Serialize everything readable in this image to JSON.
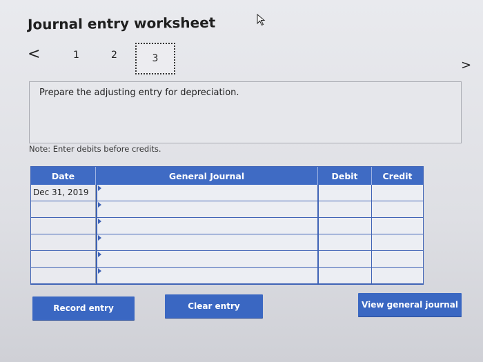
{
  "title": "Journal entry worksheet",
  "stepper": {
    "prev": "<",
    "steps": [
      "1",
      "2",
      "3"
    ],
    "next": ">"
  },
  "instruction": "Prepare the adjusting entry for depreciation.",
  "note": "Note: Enter debits before credits.",
  "journal": {
    "headers": {
      "date": "Date",
      "general_journal": "General Journal",
      "debit": "Debit",
      "credit": "Credit"
    },
    "rows": [
      {
        "date": "Dec 31, 2019",
        "account": "",
        "debit": "",
        "credit": ""
      },
      {
        "date": "",
        "account": "",
        "debit": "",
        "credit": ""
      },
      {
        "date": "",
        "account": "",
        "debit": "",
        "credit": ""
      },
      {
        "date": "",
        "account": "",
        "debit": "",
        "credit": ""
      },
      {
        "date": "",
        "account": "",
        "debit": "",
        "credit": ""
      },
      {
        "date": "",
        "account": "",
        "debit": "",
        "credit": ""
      }
    ]
  },
  "buttons": {
    "record": "Record entry",
    "clear": "Clear entry",
    "view": "View general journal"
  },
  "colors": {
    "accent": "#3a67c2",
    "header": "#3f6bc4"
  },
  "icons": {
    "cursor": "pointer-cursor-icon"
  }
}
